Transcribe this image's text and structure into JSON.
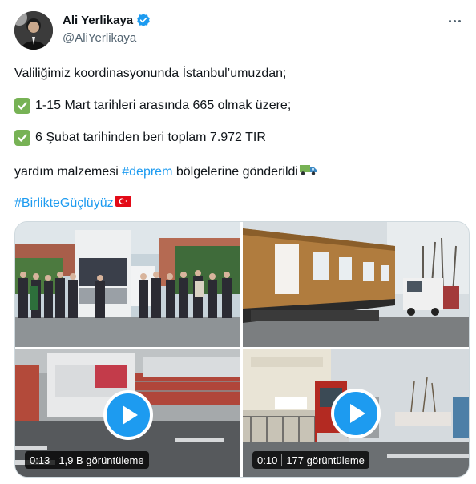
{
  "author": {
    "display_name": "Ali Yerlikaya",
    "handle": "@AliYerlikaya",
    "verified": true
  },
  "tweet": {
    "line1": "Valiliğimiz koordinasyonunda İstanbul’umuzdan;",
    "line2": "1-15 Mart tarihleri arasında 665 olmak üzere;",
    "line3": "6 Şubat tarihinden beri toplam 7.972 TIR",
    "line4_before": "yardım malzemesi ",
    "line4_hashtag": "#deprem",
    "line4_after": " bölgelerine gönderildi",
    "hashtag2": "#BirlikteGüçlüyüz"
  },
  "media": {
    "videos": [
      {
        "duration": "0:13",
        "views": "1,9 B görüntüleme"
      },
      {
        "duration": "0:10",
        "views": "177 görüntüleme"
      }
    ]
  },
  "icons": {
    "verified": "verified-badge-icon",
    "more": "more-options-icon",
    "check": "check-mark-icon",
    "truck": "truck-icon",
    "flag": "turkey-flag-icon",
    "play": "play-icon"
  },
  "colors": {
    "accent": "#1d9bf0",
    "text": "#0f1419",
    "secondary": "#536471",
    "check_green": "#77b255",
    "flag_red": "#e30a17"
  }
}
